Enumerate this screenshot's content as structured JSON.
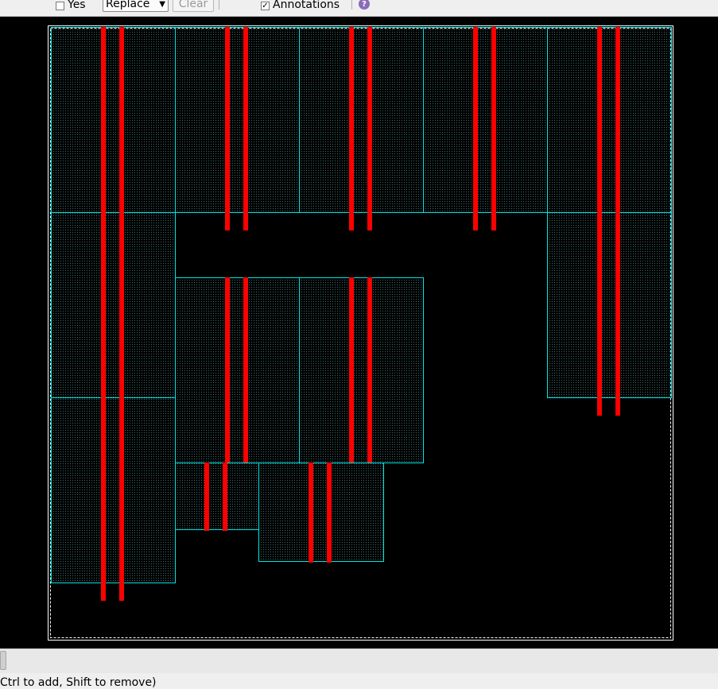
{
  "toolbar": {
    "yes_label": "Yes",
    "yes_checked": false,
    "mode_select": "Replace",
    "clear_label": "Clear",
    "annotations_label": "Annotations",
    "annotations_checked": true,
    "check_glyph": "✓",
    "help_glyph": "?"
  },
  "canvas": {
    "background": "#000000",
    "cell_outline_color": "#00e5e5",
    "rail_color": "#ff0000",
    "boundary_color": "#ffffff"
  },
  "status": {
    "text": "Ctrl to add, Shift to remove)"
  }
}
